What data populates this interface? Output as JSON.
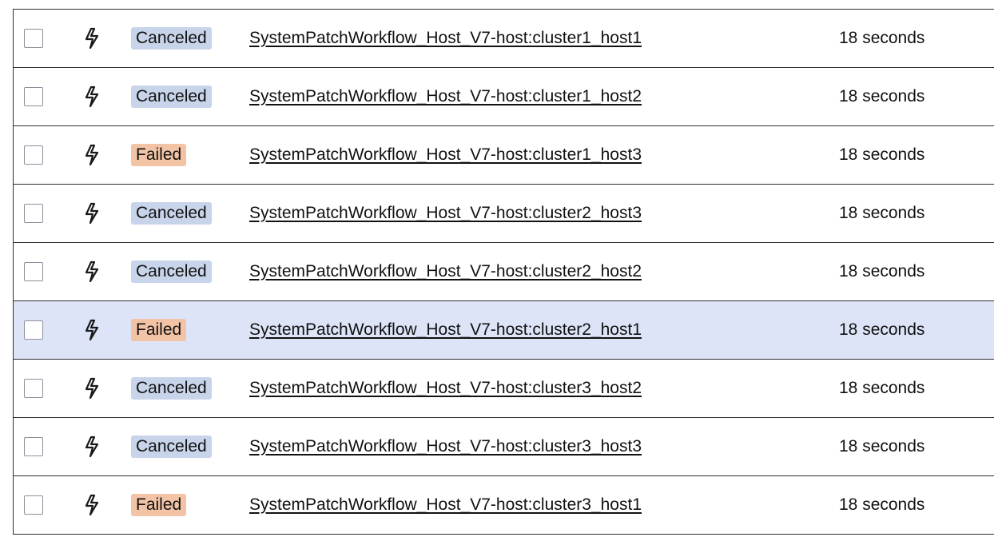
{
  "colors": {
    "canceled_badge": "#c8d4ea",
    "failed_badge": "#f2c3a4",
    "selected_row": "#dde4f8",
    "border": "#2f2f2f"
  },
  "rows": [
    {
      "status": "Canceled",
      "status_key": "canceled",
      "workflow": "SystemPatchWorkflow_Host_V7-host:cluster1_host1",
      "duration": "18 seconds",
      "icon": "bolt-icon",
      "selected": false
    },
    {
      "status": "Canceled",
      "status_key": "canceled",
      "workflow": "SystemPatchWorkflow_Host_V7-host:cluster1_host2",
      "duration": "18 seconds",
      "icon": "bolt-icon",
      "selected": false
    },
    {
      "status": "Failed",
      "status_key": "failed",
      "workflow": "SystemPatchWorkflow_Host_V7-host:cluster1_host3",
      "duration": "18 seconds",
      "icon": "bolt-icon",
      "selected": false
    },
    {
      "status": "Canceled",
      "status_key": "canceled",
      "workflow": "SystemPatchWorkflow_Host_V7-host:cluster2_host3",
      "duration": "18 seconds",
      "icon": "bolt-icon",
      "selected": false
    },
    {
      "status": "Canceled",
      "status_key": "canceled",
      "workflow": "SystemPatchWorkflow_Host_V7-host:cluster2_host2",
      "duration": "18 seconds",
      "icon": "bolt-icon",
      "selected": false
    },
    {
      "status": "Failed",
      "status_key": "failed",
      "workflow": "SystemPatchWorkflow_Host_V7-host:cluster2_host1",
      "duration": "18 seconds",
      "icon": "bolt-icon",
      "selected": true
    },
    {
      "status": "Canceled",
      "status_key": "canceled",
      "workflow": "SystemPatchWorkflow_Host_V7-host:cluster3_host2",
      "duration": "18 seconds",
      "icon": "bolt-icon",
      "selected": false
    },
    {
      "status": "Canceled",
      "status_key": "canceled",
      "workflow": "SystemPatchWorkflow_Host_V7-host:cluster3_host3",
      "duration": "18 seconds",
      "icon": "bolt-icon",
      "selected": false
    },
    {
      "status": "Failed",
      "status_key": "failed",
      "workflow": "SystemPatchWorkflow_Host_V7-host:cluster3_host1",
      "duration": "18 seconds",
      "icon": "bolt-icon",
      "selected": false
    }
  ]
}
